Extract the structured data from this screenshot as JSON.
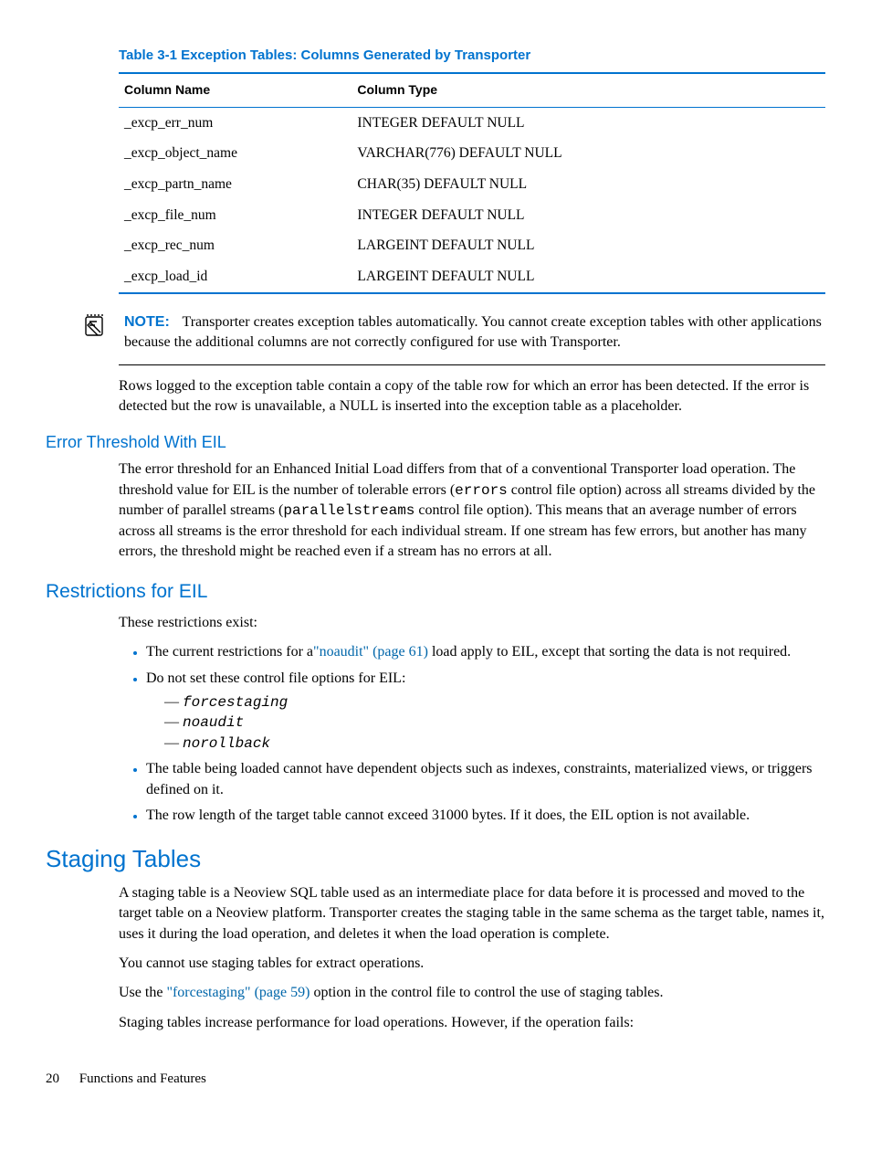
{
  "table": {
    "caption": "Table 3-1 Exception Tables: Columns Generated by Transporter",
    "headers": {
      "c1": "Column Name",
      "c2": "Column Type"
    },
    "rows": [
      {
        "name": "_excp_err_num",
        "type": "INTEGER DEFAULT NULL"
      },
      {
        "name": "_excp_object_name",
        "type": "VARCHAR(776) DEFAULT NULL"
      },
      {
        "name": "_excp_partn_name",
        "type": "CHAR(35) DEFAULT NULL"
      },
      {
        "name": "_excp_file_num",
        "type": "INTEGER DEFAULT NULL"
      },
      {
        "name": "_excp_rec_num",
        "type": "LARGEINT DEFAULT NULL"
      },
      {
        "name": "_excp_load_id",
        "type": "LARGEINT DEFAULT NULL"
      }
    ]
  },
  "note": {
    "label": "NOTE:",
    "text": "Transporter creates exception tables automatically. You cannot create exception tables with other applications because the additional columns are not correctly configured for use with Transporter."
  },
  "para_rows_logged": "Rows logged to the exception table contain a copy of the table row for which an error has been detected. If the error is detected but the row is unavailable, a NULL is inserted into the exception table as a placeholder.",
  "eil_threshold": {
    "heading": "Error Threshold With EIL",
    "p1_a": "The error threshold for an Enhanced Initial Load differs from that of a conventional Transporter load operation. The threshold value for EIL is the number of tolerable errors (",
    "code1": "errors",
    "p1_b": " control file option) across all streams divided by the number of parallel streams (",
    "code2": "parallelstreams",
    "p1_c": " control file option). This means that an average number of errors across all streams is the error threshold for each individual stream. If one stream has few errors, but another has many errors, the threshold might be reached even if a stream has no errors at all."
  },
  "restrictions": {
    "heading": "Restrictions for EIL",
    "intro": "These restrictions exist:",
    "b1_a": "The current restrictions for a",
    "b1_link": "\"noaudit\" (page 61)",
    "b1_b": " load apply to EIL, except that sorting the data is not required.",
    "b2": "Do not set these control file options for EIL:",
    "opts": {
      "o1": "forcestaging",
      "o2": "noaudit",
      "o3": "norollback"
    },
    "b3": "The table being loaded cannot have dependent objects such as indexes, constraints, materialized views, or triggers defined on it.",
    "b4": "The row length of the target table cannot exceed 31000 bytes. If it does, the EIL option is not available."
  },
  "staging": {
    "heading": "Staging Tables",
    "p1": "A staging table is a Neoview SQL table used as an intermediate place for data before it is processed and moved to the target table on a Neoview platform. Transporter creates the staging table in the same schema as the target table, names it, uses it during the load operation, and deletes it when the load operation is complete.",
    "p2": "You cannot use staging tables for extract operations.",
    "p3_a": "Use the ",
    "p3_link": "\"forcestaging\" (page 59)",
    "p3_b": " option in the control file to control the use of staging tables.",
    "p4": "Staging tables increase performance for load operations. However, if the operation fails:"
  },
  "footer": {
    "page": "20",
    "section": "Functions and Features"
  }
}
